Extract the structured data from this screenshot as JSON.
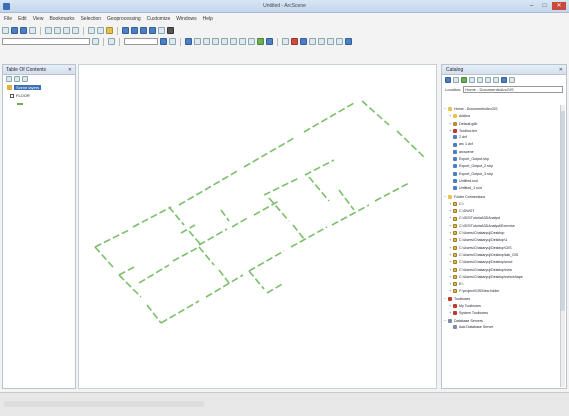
{
  "window": {
    "title": "Untitled - ArcScene"
  },
  "menu": {
    "items": [
      "File",
      "Edit",
      "View",
      "Bookmarks",
      "Selection",
      "Geoprocessing",
      "Customize",
      "Windows",
      "Help"
    ]
  },
  "toolbar": {
    "layer_combo": ""
  },
  "toc": {
    "title": "Table Of Contents",
    "scene_layers": "Scene layers",
    "layer_name": "FLOOR"
  },
  "catalog": {
    "title": "Catalog",
    "location_label": "Location:",
    "location_value": "Home - Documents\\ArcGIS",
    "tree": [
      {
        "level": 0,
        "exp": "−",
        "icon": "folder",
        "label": "Home - Documents\\ArcGIS"
      },
      {
        "level": 1,
        "exp": "+",
        "icon": "folder",
        "label": "AddIns"
      },
      {
        "level": 1,
        "exp": "+",
        "icon": "gdb",
        "label": "Default.gdb"
      },
      {
        "level": 1,
        "exp": "+",
        "icon": "box",
        "label": "Toolbox.tbx"
      },
      {
        "level": 1,
        "exp": "",
        "icon": "fc",
        "label": "2.dxf"
      },
      {
        "level": 1,
        "exp": "",
        "icon": "fc",
        "label": "arc 1.dxf"
      },
      {
        "level": 1,
        "exp": "",
        "icon": "fc",
        "label": "arcscene"
      },
      {
        "level": 1,
        "exp": "",
        "icon": "fc",
        "label": "Export_Output.shp"
      },
      {
        "level": 1,
        "exp": "",
        "icon": "fc",
        "label": "Export_Output_2.shp"
      },
      {
        "level": 1,
        "exp": "",
        "icon": "fc",
        "label": "Export_Output_3.shp"
      },
      {
        "level": 1,
        "exp": "",
        "icon": "fc",
        "label": "Untitled.sxd"
      },
      {
        "level": 1,
        "exp": "",
        "icon": "fc",
        "label": "Untitled_1.sxd"
      },
      {
        "level": 0,
        "exp": "−",
        "icon": "folder",
        "label": "Folder Connections"
      },
      {
        "level": 1,
        "exp": "+",
        "icon": "conn",
        "label": "C:\\"
      },
      {
        "level": 1,
        "exp": "+",
        "icon": "conn",
        "label": "C:\\DWGT"
      },
      {
        "level": 1,
        "exp": "+",
        "icon": "conn",
        "label": "C:\\GIS\\Tutorial\\3DAnalyst"
      },
      {
        "level": 1,
        "exp": "+",
        "icon": "conn",
        "label": "C:\\GIS\\Tutorial\\3DAnalyst\\Exercise"
      },
      {
        "level": 1,
        "exp": "+",
        "icon": "conn",
        "label": "C:\\Users\\Chakaryuj\\Desktop"
      },
      {
        "level": 1,
        "exp": "+",
        "icon": "conn",
        "label": "C:\\Users\\Chakaryuj\\Desktop\\1"
      },
      {
        "level": 1,
        "exp": "+",
        "icon": "conn",
        "label": "C:\\Users\\Chakaryuj\\Desktop\\GIS"
      },
      {
        "level": 1,
        "exp": "+",
        "icon": "conn",
        "label": "C:\\Users\\Chakaryuj\\Desktop\\lab_GIS"
      },
      {
        "level": 1,
        "exp": "+",
        "icon": "conn",
        "label": "C:\\Users\\Chakaryuj\\Desktop\\mod"
      },
      {
        "level": 1,
        "exp": "+",
        "icon": "conn",
        "label": "C:\\Users\\Chakaryuj\\Desktop\\new"
      },
      {
        "level": 1,
        "exp": "+",
        "icon": "conn",
        "label": "C:\\Users\\Chakaryuj\\Desktop\\new\\shape"
      },
      {
        "level": 1,
        "exp": "+",
        "icon": "conn",
        "label": "E:\\"
      },
      {
        "level": 1,
        "exp": "+",
        "icon": "conn",
        "label": "F:\\project\\GIS\\New folder"
      },
      {
        "level": 0,
        "exp": "−",
        "icon": "tool",
        "label": "Toolboxes"
      },
      {
        "level": 1,
        "exp": "+",
        "icon": "tool",
        "label": "My Toolboxes"
      },
      {
        "level": 1,
        "exp": "+",
        "icon": "tool",
        "label": "System Toolboxes"
      },
      {
        "level": 0,
        "exp": "−",
        "icon": "db",
        "label": "Database Servers"
      },
      {
        "level": 1,
        "exp": "",
        "icon": "db",
        "label": "Add Database Server"
      }
    ]
  },
  "colors": {
    "wall_lines": "#7bbf6a",
    "selection": "#3d6fb4"
  }
}
